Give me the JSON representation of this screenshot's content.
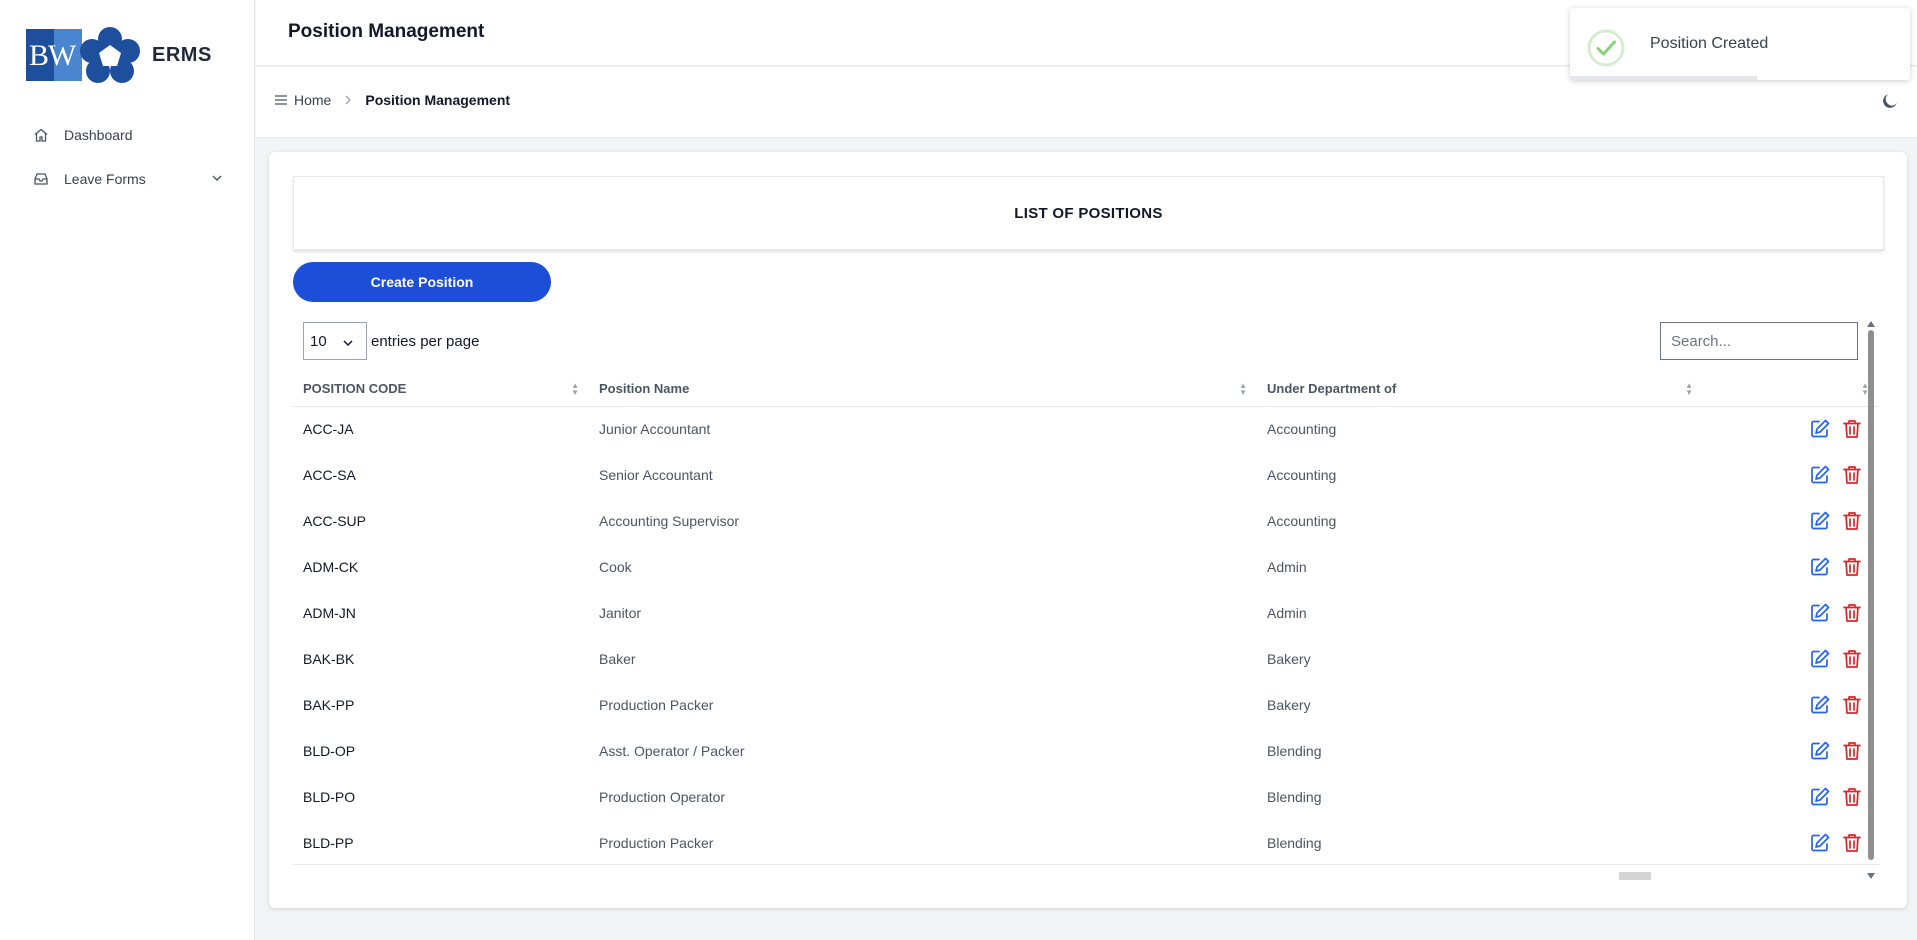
{
  "app": {
    "title": "ERMS",
    "logo_text": "BW"
  },
  "sidebar": {
    "items": [
      {
        "label": "Dashboard",
        "icon": "home-icon"
      },
      {
        "label": "Leave Forms",
        "icon": "inbox-icon",
        "expandable": true
      }
    ]
  },
  "header": {
    "title": "Position Management"
  },
  "breadcrumb": {
    "home": "Home",
    "current": "Position Management"
  },
  "main": {
    "list_title": "LIST OF POSITIONS",
    "create_button": "Create Position",
    "entries": {
      "value": "10",
      "label": "entries per page"
    },
    "search": {
      "placeholder": "Search..."
    },
    "columns": [
      "POSITION CODE",
      "Position Name",
      "Under Department of",
      ""
    ],
    "rows": [
      {
        "code": "ACC-JA",
        "name": "Junior Accountant",
        "dept": "Accounting"
      },
      {
        "code": "ACC-SA",
        "name": "Senior Accountant",
        "dept": "Accounting"
      },
      {
        "code": "ACC-SUP",
        "name": "Accounting Supervisor",
        "dept": "Accounting"
      },
      {
        "code": "ADM-CK",
        "name": "Cook",
        "dept": "Admin"
      },
      {
        "code": "ADM-JN",
        "name": "Janitor",
        "dept": "Admin"
      },
      {
        "code": "BAK-BK",
        "name": "Baker",
        "dept": "Bakery"
      },
      {
        "code": "BAK-PP",
        "name": "Production Packer",
        "dept": "Bakery"
      },
      {
        "code": "BLD-OP",
        "name": "Asst. Operator / Packer",
        "dept": "Blending"
      },
      {
        "code": "BLD-PO",
        "name": "Production Operator",
        "dept": "Blending"
      },
      {
        "code": "BLD-PP",
        "name": "Production Packer",
        "dept": "Blending"
      }
    ]
  },
  "toast": {
    "message": "Position Created",
    "progress": 0.55
  },
  "colors": {
    "primary": "#1d4ed8",
    "edit": "#2563eb",
    "delete": "#dc2626",
    "success": "#86d37a"
  }
}
